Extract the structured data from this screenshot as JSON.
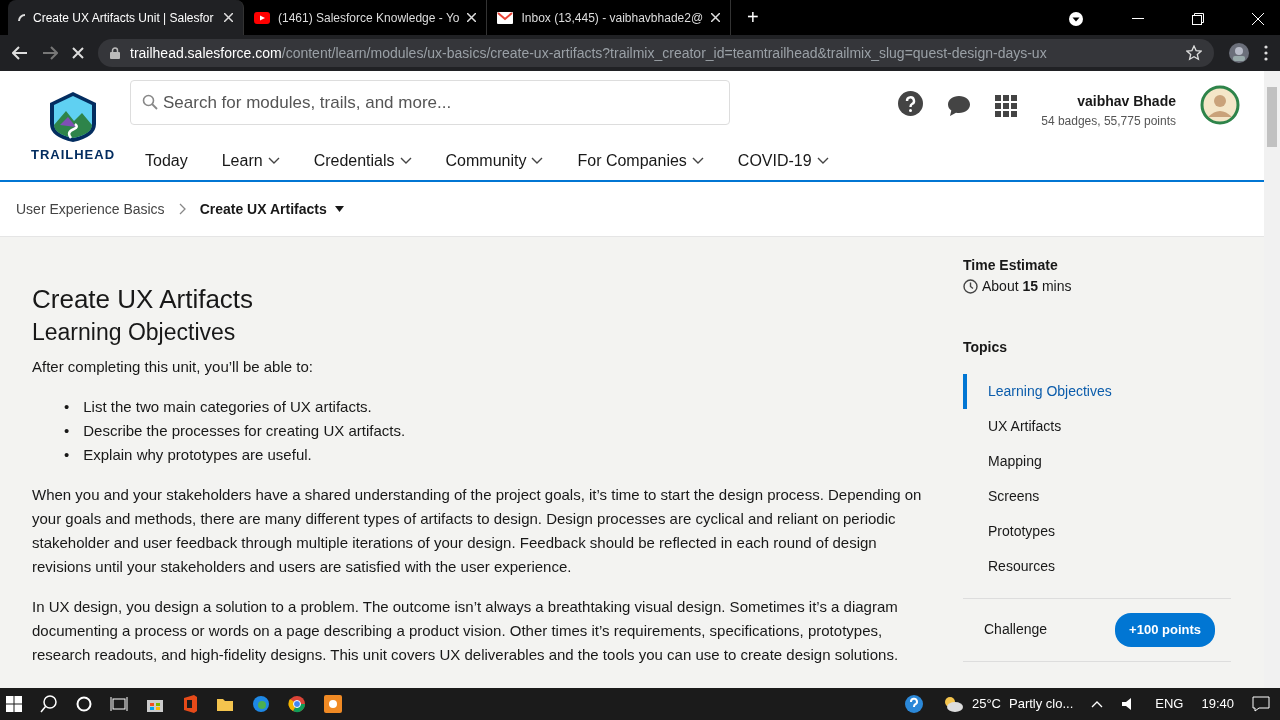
{
  "browser": {
    "tabs": [
      {
        "title": "Create UX Artifacts Unit | Salesfor",
        "kind": "loading",
        "selected": true
      },
      {
        "title": "(1461) Salesforce Knowledge - Yo",
        "kind": "video",
        "selected": false
      },
      {
        "title": "Inbox (13,445) - vaibhavbhade2@",
        "kind": "mail",
        "selected": false
      }
    ],
    "new_tab": "+",
    "url": {
      "host": "trailhead.salesforce.com",
      "path": "/content/learn/modules/ux-basics/create-ux-artifacts?trailmix_creator_id=teamtrailhead&trailmix_slug=quest-design-days-ux"
    }
  },
  "header": {
    "logo_text": "TRAILHEAD",
    "search": {
      "placeholder": "Search for modules, trails, and more..."
    },
    "user": {
      "name": "vaibhav Bhade",
      "stats": "54 badges, 55,775 points"
    },
    "nav": [
      {
        "label": "Today",
        "has_menu": false
      },
      {
        "label": "Learn",
        "has_menu": true
      },
      {
        "label": "Credentials",
        "has_menu": true
      },
      {
        "label": "Community",
        "has_menu": true
      },
      {
        "label": "For Companies",
        "has_menu": true
      },
      {
        "label": "COVID-19",
        "has_menu": true
      }
    ]
  },
  "breadcrumb": [
    {
      "label": "User Experience Basics",
      "current": false
    },
    {
      "label": "Create UX Artifacts",
      "current": true
    }
  ],
  "article": {
    "title": "Create UX Artifacts",
    "subtitle": "Learning Objectives",
    "intro": "After completing this unit, you’ll be able to:",
    "objectives": [
      {
        "marker": "•",
        "text": "List the two main categories of UX artifacts."
      },
      {
        "marker": "•",
        "text": "Describe the processes for creating UX artifacts."
      },
      {
        "marker": "•",
        "text": "Explain why prototypes are useful."
      }
    ],
    "paragraphs": [
      "When you and your stakeholders have a shared understanding of the project goals, it’s time to start the design process. Depending on your goals and methods, there are many different types of artifacts to design. Design processes are cyclical and reliant on periodic stakeholder and user feedback through multiple iterations of your design. Feedback should be reflected in each round of design revisions until your stakeholders and users are satisfied with the user experience.",
      "In UX design, you design a solution to a problem. The outcome isn’t always a breathtaking visual design. Sometimes it’s a diagram documenting a process or words on a page describing a product vision. Other times it’s requirements, specifications, prototypes, research readouts, and high-fidelity designs. This unit covers UX deliverables and the tools you can use to create design solutions."
    ]
  },
  "sidebar": {
    "time_heading": "Time Estimate",
    "time_text": "About **15** mins",
    "topics_heading": "Topics",
    "topics": [
      {
        "label": "Learning Objectives",
        "selected": true
      },
      {
        "label": "UX Artifacts",
        "selected": false
      },
      {
        "label": "Mapping",
        "selected": false
      },
      {
        "label": "Screens",
        "selected": false
      },
      {
        "label": "Prototypes",
        "selected": false
      },
      {
        "label": "Resources",
        "selected": false
      }
    ],
    "challenge": {
      "label": "Challenge",
      "points": "+100 points"
    }
  },
  "taskbar": {
    "weather": "25°C",
    "weather_text": "Partly clo...",
    "language": "ENG",
    "time": "19:40"
  }
}
